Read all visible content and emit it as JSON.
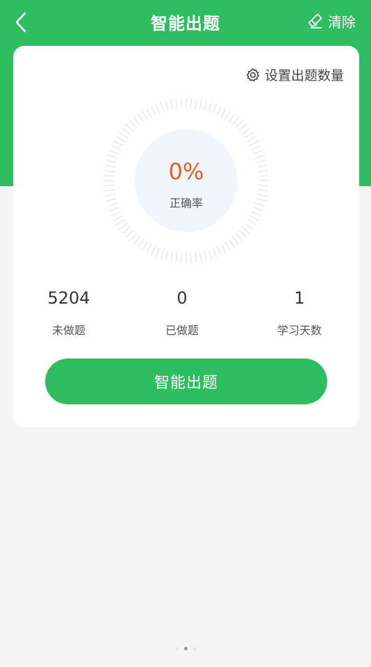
{
  "header": {
    "title": "智能出题",
    "clear_label": "清除"
  },
  "card": {
    "settings_label": "设置出题数量",
    "accuracy_value": "0%",
    "accuracy_label": "正确率",
    "stats": [
      {
        "value": "5204",
        "label": "未做题"
      },
      {
        "value": "0",
        "label": "已做题"
      },
      {
        "value": "1",
        "label": "学习天数"
      }
    ],
    "cta_label": "智能出题"
  },
  "colors": {
    "primary": "#2fbd62",
    "accuracy": "#f05a1e",
    "background": "#f4f4f4"
  },
  "page_indicator": {
    "count": 3,
    "active_index": 1
  },
  "icons": [
    "back-chevron-icon",
    "eraser-icon",
    "gear-icon"
  ]
}
